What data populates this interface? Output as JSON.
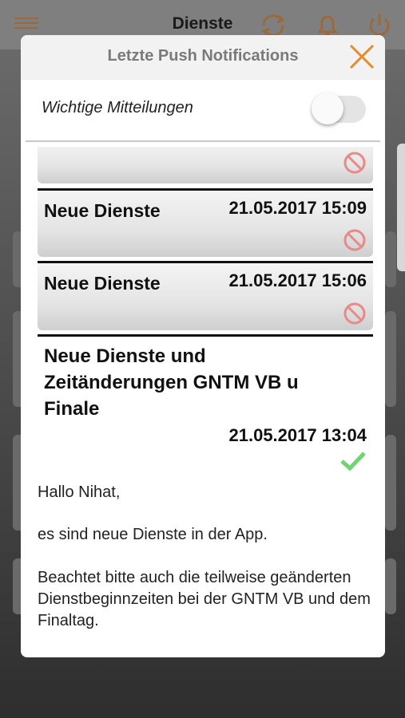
{
  "background": {
    "title": "Dienste",
    "icons": [
      "menu-icon",
      "sync-icon",
      "bell-icon",
      "power-icon"
    ]
  },
  "modal": {
    "title": "Letzte Push Notifications",
    "setting_label": "Wichtige Mitteilungen",
    "toggle_on": false
  },
  "notifications": [
    {
      "title": "",
      "date": "",
      "status": "blocked-icon"
    },
    {
      "title": "Neue Dienste",
      "date": "21.05.2017 15:09",
      "status": "blocked-icon"
    },
    {
      "title": "Neue Dienste",
      "date": "21.05.2017 15:06",
      "status": "blocked-icon"
    }
  ],
  "open_notification": {
    "title": "Neue Dienste und Zeitänderungen GNTM VB u Finale",
    "date": "21.05.2017 13:04",
    "status": "check-icon",
    "message_greeting": "Hallo Nihat,",
    "message_p1": "es sind neue Dienste in der App.",
    "message_p2": "Beachtet bitte auch die teilweise geänderten Dienstbeginnzeiten bei der GNTM VB und dem Finaltag."
  },
  "colors": {
    "accent": "#e8892a",
    "blocked": "#e88a8a",
    "check": "#6fd66f"
  }
}
